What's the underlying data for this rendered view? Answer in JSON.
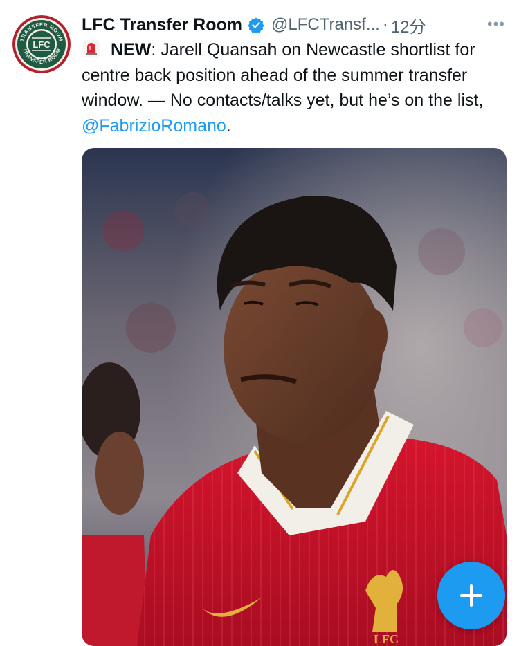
{
  "author": {
    "display_name": "LFC Transfer Room",
    "handle": "@LFCTransf...",
    "separator": "·",
    "time": "12分",
    "more": "•••",
    "avatar_lettering": [
      "TRANSFER ROOM",
      "LFC",
      "TRANSFER ROOM"
    ]
  },
  "tweet": {
    "icon": "siren-emoji",
    "bold_prefix": "NEW",
    "text": ": Jarell Quansah on Newcastle shortlist for centre back position ahead of the summer transfer window. — No contacts/talks yet, but he’s on the list, ",
    "mention": "@FabrizioRomano",
    "suffix": "."
  },
  "media": {
    "description_icon": "photo",
    "crest_text": "LFC"
  },
  "compose_button": {
    "icon": "plus-icon"
  },
  "colors": {
    "accent": "#1d9bf0",
    "avatar_green": "#1f5a43",
    "avatar_red": "#b4202c",
    "kit_red": "#c8102e"
  }
}
